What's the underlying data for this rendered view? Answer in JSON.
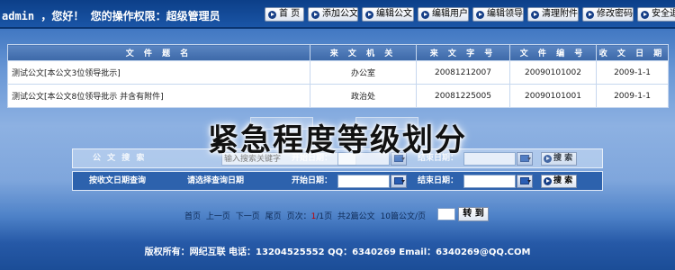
{
  "header": {
    "welcome_text": "admin ，您好！ 您的操作权限：超级管理员",
    "nav": [
      "首 页",
      "添加公文",
      "编辑公文",
      "编辑用户",
      "编辑领导",
      "清理附件",
      "修改密码",
      "安全退"
    ]
  },
  "table": {
    "columns": [
      "文 件 题 名",
      "来 文 机 关",
      "来 文 字 号",
      "文 件 编 号",
      "收 文 日 期"
    ],
    "rows": [
      [
        "测试公文[本公文3位领导批示]",
        "办公室",
        "20081212007",
        "20090101002",
        "2009-1-1"
      ],
      [
        "测试公文[本公文8位领导批示 并含有附件]",
        "政治处",
        "20081225005",
        "20090101001",
        "2009-1-1"
      ]
    ]
  },
  "overlay": {
    "title": "紧急程度等级划分"
  },
  "search": {
    "row1_label": "公 文 搜 索",
    "row1_placeholder": "输入搜索关键字",
    "start_date_label": "开始日期：",
    "end_date_label": "结束日期：",
    "search_button": "搜 索",
    "row2_label": "按收文日期查询",
    "row2_hint": "请选择查询日期"
  },
  "pager": {
    "first": "首页",
    "prev": "上一页",
    "next": "下一页",
    "last": "尾页",
    "page_prefix": "页次：",
    "current_page": "1",
    "page_suffix": "/1页",
    "total": "共2篇公文",
    "per_page": "10篇公文/页",
    "go_button": "转 到"
  },
  "footer": {
    "text": "版权所有：网纪互联  电话：13204525552  QQ：6340269  Email：6340269@QQ.COM"
  },
  "colors": {
    "topbar": "#0c3f88",
    "table_header": "#4a76b5",
    "panel": "#2d62ad",
    "current_page": "#c00000"
  }
}
